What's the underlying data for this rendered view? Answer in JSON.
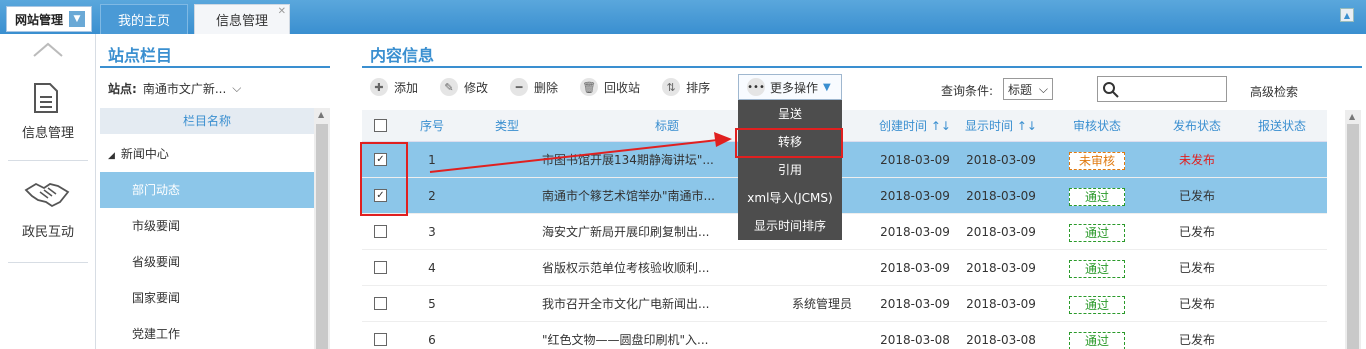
{
  "topbar": {
    "site_menu": "网站管理",
    "tabs": [
      {
        "label": "我的主页",
        "active": true
      },
      {
        "label": "信息管理",
        "active": false
      }
    ]
  },
  "leftnav": {
    "items": [
      {
        "label": "信息管理",
        "icon": "document-icon"
      },
      {
        "label": "政民互动",
        "icon": "handshake-icon"
      }
    ]
  },
  "column_panel": {
    "title": "站点栏目",
    "site_label": "站点:",
    "site_value": "南通市文广新...",
    "tree_header": "栏目名称",
    "tree": [
      {
        "label": "新闻中心",
        "expanded": true,
        "active": false
      },
      {
        "label": "部门动态",
        "active": true
      },
      {
        "label": "市级要闻",
        "active": false
      },
      {
        "label": "省级要闻",
        "active": false
      },
      {
        "label": "国家要闻",
        "active": false
      },
      {
        "label": "党建工作",
        "active": false
      }
    ]
  },
  "content": {
    "title": "内容信息",
    "toolbar": [
      {
        "label": "添加",
        "icon": "plus-icon"
      },
      {
        "label": "修改",
        "icon": "pencil-icon"
      },
      {
        "label": "删除",
        "icon": "minus-icon"
      },
      {
        "label": "回收站",
        "icon": "trash-icon"
      },
      {
        "label": "排序",
        "icon": "sort-icon"
      }
    ],
    "more_label": "更多操作",
    "more_menu": [
      "呈送",
      "转移",
      "引用",
      "xml导入(JCMS)",
      "显示时间排序"
    ],
    "query_label": "查询条件:",
    "query_value": "标题",
    "advanced_search": "高级检索",
    "columns": [
      "序号",
      "类型",
      "标题",
      "",
      "创建时间 ↑↓",
      "显示时间 ↑↓",
      "审核状态",
      "发布状态",
      "报送状态"
    ],
    "rows": [
      {
        "no": "1",
        "title": "市图书馆开展134期静海讲坛\"...",
        "author": "",
        "created": "2018-03-09",
        "shown": "2018-03-09",
        "audit": "未审核",
        "audit_ok": false,
        "publish": "未发布",
        "published": false,
        "checked": true
      },
      {
        "no": "2",
        "title": "南通市个簃艺术馆举办\"南通市...",
        "author": "",
        "created": "2018-03-09",
        "shown": "2018-03-09",
        "audit": "通过",
        "audit_ok": true,
        "publish": "已发布",
        "published": true,
        "checked": true
      },
      {
        "no": "3",
        "title": "海安文广新局开展印刷复制出...",
        "author": "",
        "created": "2018-03-09",
        "shown": "2018-03-09",
        "audit": "通过",
        "audit_ok": true,
        "publish": "已发布",
        "published": true,
        "checked": false
      },
      {
        "no": "4",
        "title": "省版权示范单位考核验收顺利...",
        "author": "",
        "created": "2018-03-09",
        "shown": "2018-03-09",
        "audit": "通过",
        "audit_ok": true,
        "publish": "已发布",
        "published": true,
        "checked": false
      },
      {
        "no": "5",
        "title": "我市召开全市文化广电新闻出...",
        "author": "系统管理员",
        "created": "2018-03-09",
        "shown": "2018-03-09",
        "audit": "通过",
        "audit_ok": true,
        "publish": "已发布",
        "published": true,
        "checked": false
      },
      {
        "no": "6",
        "title": "\"红色文物——圆盘印刷机\"入...",
        "author": "",
        "created": "2018-03-08",
        "shown": "2018-03-08",
        "audit": "通过",
        "audit_ok": true,
        "publish": "已发布",
        "published": true,
        "checked": false
      }
    ]
  },
  "colors": {
    "accent": "#3a8fd0",
    "selected_row": "#8cc6e9",
    "highlight": "#e02020",
    "menu_bg": "#4d4d4d"
  }
}
